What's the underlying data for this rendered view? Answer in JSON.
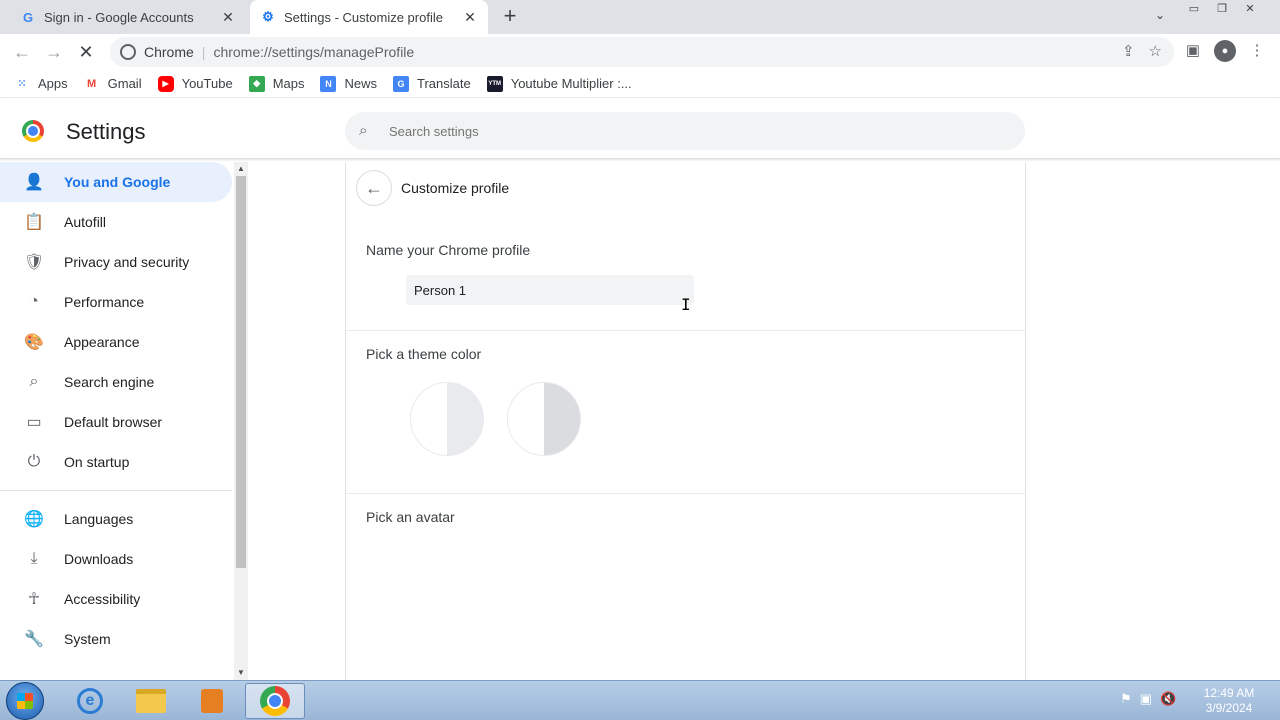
{
  "browser": {
    "tabs": [
      {
        "title": "Sign in - Google Accounts",
        "favicon": "google-g-icon",
        "active": false
      },
      {
        "title": "Settings - Customize profile",
        "favicon": "settings-gear-icon",
        "active": true
      }
    ],
    "omnibox": {
      "site": "Chrome",
      "url": "chrome://settings/manageProfile"
    },
    "bookmarks": [
      {
        "label": "Apps",
        "icon": "apps-grid-icon"
      },
      {
        "label": "Gmail",
        "icon": "gmail-icon"
      },
      {
        "label": "YouTube",
        "icon": "youtube-icon"
      },
      {
        "label": "Maps",
        "icon": "maps-icon"
      },
      {
        "label": "News",
        "icon": "news-icon"
      },
      {
        "label": "Translate",
        "icon": "translate-icon"
      },
      {
        "label": "Youtube Multiplier :...",
        "icon": "ytm-icon"
      }
    ]
  },
  "settings": {
    "title": "Settings",
    "search_placeholder": "Search settings",
    "nav": [
      {
        "label": "You and Google",
        "icon": "person-icon",
        "selected": true
      },
      {
        "label": "Autofill",
        "icon": "clipboard-icon"
      },
      {
        "label": "Privacy and security",
        "icon": "shield-icon"
      },
      {
        "label": "Performance",
        "icon": "speedometer-icon"
      },
      {
        "label": "Appearance",
        "icon": "palette-icon"
      },
      {
        "label": "Search engine",
        "icon": "search-icon"
      },
      {
        "label": "Default browser",
        "icon": "browser-window-icon"
      },
      {
        "label": "On startup",
        "icon": "power-icon"
      },
      {
        "label": "Languages",
        "icon": "globe-icon"
      },
      {
        "label": "Downloads",
        "icon": "download-icon"
      },
      {
        "label": "Accessibility",
        "icon": "accessibility-icon"
      },
      {
        "label": "System",
        "icon": "wrench-icon"
      }
    ]
  },
  "profile": {
    "page_title": "Customize profile",
    "name_label": "Name your Chrome profile",
    "name_value": "Person 1",
    "theme_label": "Pick a theme color",
    "avatar_label": "Pick an avatar"
  },
  "taskbar": {
    "time": "12:49 AM",
    "date": "3/9/2024"
  }
}
